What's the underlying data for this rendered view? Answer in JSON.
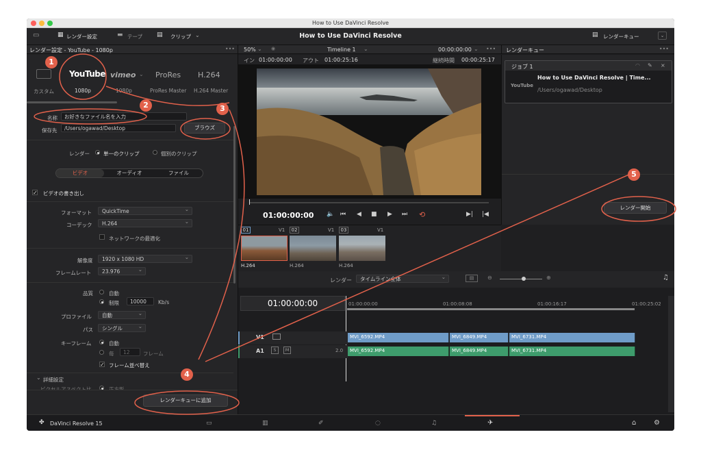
{
  "window": {
    "title": "How to Use DaVinci Resolve"
  },
  "menubar": {
    "render_settings": "レンダー設定",
    "tape": "テープ",
    "clip": "クリップ",
    "project_title": "How to Use DaVinci Resolve",
    "render_queue": "レンダーキュー"
  },
  "render_panel": {
    "header": "レンダー設定 - YouTube - 1080p",
    "presets": [
      {
        "logo": "",
        "label": "カスタム"
      },
      {
        "logo": "YouTube",
        "label": "1080p"
      },
      {
        "logo": "vimeo",
        "label": "1080p"
      },
      {
        "logo": "ProRes",
        "label": "ProRes Master"
      },
      {
        "logo": "H.264",
        "label": "H.264 Master"
      }
    ],
    "name_label": "名称",
    "name_value": "お好きなファイル名を入力",
    "location_label": "保存先",
    "location_value": "/Users/ogawad/Desktop",
    "browse": "ブラウズ",
    "render_label": "レンダー",
    "single_clip": "単一のクリップ",
    "individual_clips": "個別のクリップ",
    "tabs": [
      "ビデオ",
      "オーディオ",
      "ファイル"
    ],
    "export_video": "ビデオの書き出し",
    "format_label": "フォーマット",
    "format_value": "QuickTime",
    "codec_label": "コーデック",
    "codec_value": "H.264",
    "network_opt": "ネットワークの最適化",
    "resolution_label": "解像度",
    "resolution_value": "1920 x 1080 HD",
    "framerate_label": "フレームレート",
    "framerate_value": "23.976",
    "quality_label": "品質",
    "quality_auto": "自動",
    "quality_limit": "制限",
    "bitrate_value": "10000",
    "bitrate_unit": "Kb/s",
    "profile_label": "プロファイル",
    "profile_value": "自動",
    "pass_label": "パス",
    "pass_value": "シングル",
    "keyframe_label": "キーフレーム",
    "keyframe_auto": "自動",
    "keyframe_every": "毎",
    "keyframe_every_value": "12",
    "keyframe_frames": "フレーム",
    "frame_reorder": "フレーム並べ替え",
    "advanced": "詳細設定",
    "pixel_aspect": "ピクセルアスペクト比",
    "square": "正方形",
    "add_to_queue": "レンダーキューに追加"
  },
  "viewer": {
    "zoom": "50%",
    "timeline_name": "Timeline 1",
    "timecode_top": "00:00:00:00",
    "in_label": "イン",
    "in_tc": "01:00:00:00",
    "out_label": "アウト",
    "out_tc": "01:00:25:16",
    "duration_label": "継続時間",
    "duration_tc": "00:00:25:17",
    "current_tc": "01:00:00:00"
  },
  "clips": [
    {
      "num": "01",
      "track": "V1",
      "codec": "H.264"
    },
    {
      "num": "02",
      "track": "V1",
      "codec": "H.264"
    },
    {
      "num": "03",
      "track": "V1",
      "codec": "H.264"
    }
  ],
  "timeline": {
    "render_label": "レンダー",
    "range_value": "タイムライン全体",
    "timecode": "01:00:00:00",
    "ruler": [
      "01:00:00:00",
      "01:00:08:08",
      "01:00:16:17",
      "01:00:25:02"
    ],
    "v1": "V1",
    "a1": "A1",
    "a1_s": "S",
    "a1_m": "M",
    "a1_ch": "2.0",
    "video_clips": [
      "MVI_6592.MP4",
      "MVI_6849.MP4",
      "MVI_6731.MP4"
    ],
    "audio_clips": [
      "MVI_6592.MP4",
      "MVI_6849.MP4",
      "MVI_6731.MP4"
    ]
  },
  "queue": {
    "header": "レンダーキュー",
    "job_title": "ジョブ 1",
    "job_name": "How to Use DaVinci Resolve | Time...",
    "job_path": "/Users/ogawad/Desktop",
    "job_logo": "YouTube",
    "start": "レンダー開始"
  },
  "footer": {
    "app": "DaVinci Resolve 15"
  },
  "annotations": [
    "1",
    "2",
    "3",
    "4",
    "5"
  ],
  "colors": {
    "accent": "#e2614b",
    "video_clip": "#6f9cc8",
    "audio_clip": "#3e9c6c"
  }
}
